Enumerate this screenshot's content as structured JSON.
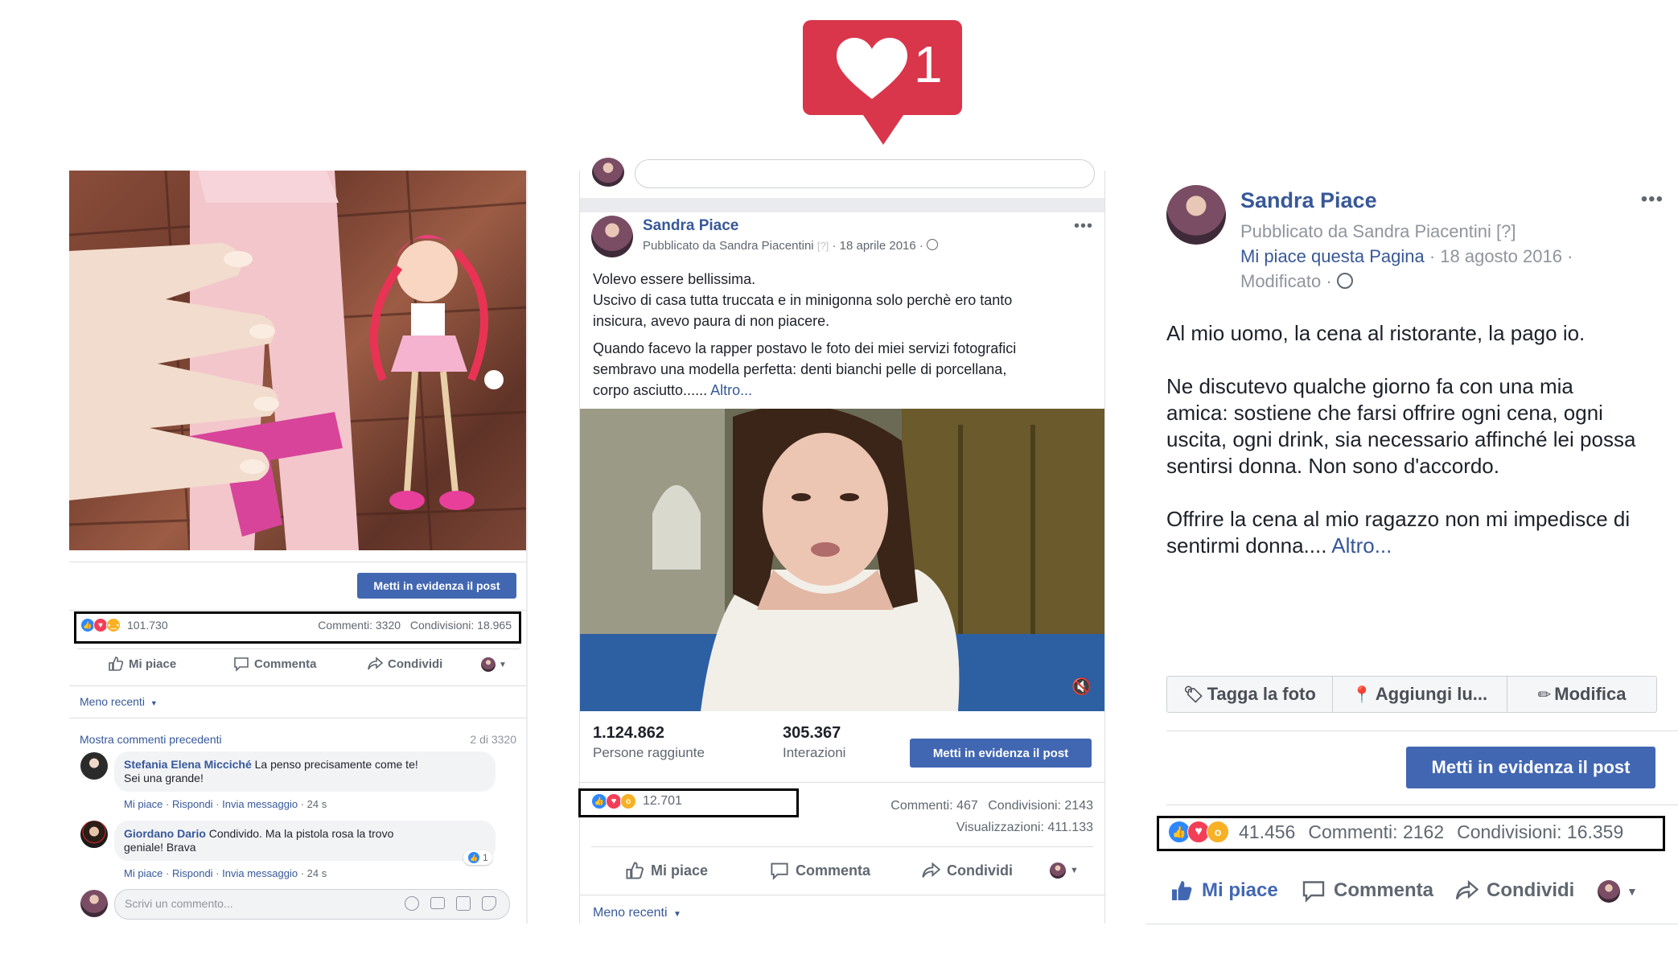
{
  "badge": {
    "count": "1"
  },
  "post1": {
    "boost_label": "Metti in evidenza il post",
    "reactions_count": "101.730",
    "comments": "Commenti: 3320",
    "shares": "Condivisioni: 18.965",
    "actions": {
      "like": "Mi piace",
      "comment": "Commenta",
      "share": "Condividi"
    },
    "filter": "Meno recenti",
    "show_prev": "Mostra commenti precedenti",
    "count_of": "2 di 3320",
    "thread": [
      {
        "author": "Stefania Elena Micciché",
        "text1": "La penso precisamente come te!",
        "text2": "Sei una grande!",
        "meta": [
          "Mi piace",
          "Rispondi",
          "Invia messaggio",
          "24 s"
        ]
      },
      {
        "author": "Giordano Dario",
        "text1": "Condivido. Ma la pistola rosa la trovo",
        "text2": "geniale! Brava",
        "meta": [
          "Mi piace",
          "Rispondi",
          "Invia messaggio",
          "24 s"
        ],
        "likes": "1"
      }
    ],
    "write_placeholder": "Scrivi un commento..."
  },
  "post2": {
    "author": "Sandra Piace",
    "published_by": "Pubblicato da Sandra Piacentini",
    "q": "[?]",
    "date": "18 aprile 2016",
    "text": [
      "Volevo essere bellissima.",
      "Uscivo di casa tutta truccata e in minigonna solo perchè ero tanto",
      "insicura, avevo paura di non piacere.",
      "Quando facevo la rapper postavo le foto dei miei servizi fotografici",
      "sembravo una modella perfetta: denti bianchi pelle di porcellana,",
      "corpo asciutto......"
    ],
    "more": "Altro...",
    "reach_value": "1.124.862",
    "reach_label": "Persone raggiunte",
    "interactions_value": "305.367",
    "interactions_label": "Interazioni",
    "boost_label": "Metti in evidenza il post",
    "reactions_count": "12.701",
    "comments": "Commenti: 467",
    "shares": "Condivisioni: 2143",
    "views": "Visualizzazioni: 411.133",
    "actions": {
      "like": "Mi piace",
      "comment": "Commenta",
      "share": "Condividi"
    },
    "filter": "Meno recenti"
  },
  "post3": {
    "author": "Sandra Piace",
    "published_by": "Pubblicato da Sandra Piacentini",
    "q": "[?]",
    "like_page": "Mi piace questa Pagina",
    "date": "· 18 agosto 2016 ·",
    "modified": "Modificato ·",
    "paragraphs": [
      [
        "Al mio uomo, la cena al ristorante, la pago io."
      ],
      [
        "Ne discutevo qualche giorno fa con una mia",
        "amica: sostiene che farsi offrire ogni cena, ogni",
        "uscita, ogni drink, sia necessario affinché lei possa",
        "sentirsi donna. Non sono d'accordo."
      ],
      [
        "Offrire la cena al mio ragazzo non mi impedisce di",
        "sentirmi donna...."
      ]
    ],
    "more": "Altro...",
    "tools": {
      "tag": "Tagga la foto",
      "place": "Aggiungi lu...",
      "edit": "Modifica"
    },
    "boost_label": "Metti in evidenza il post",
    "reactions_count": "41.456",
    "comments": "Commenti: 2162",
    "shares": "Condivisioni: 16.359",
    "actions": {
      "like": "Mi piace",
      "comment": "Commenta",
      "share": "Condividi"
    }
  },
  "colors": {
    "badge": "#d9364b",
    "fb_blue": "#4267b2",
    "link": "#385898"
  }
}
